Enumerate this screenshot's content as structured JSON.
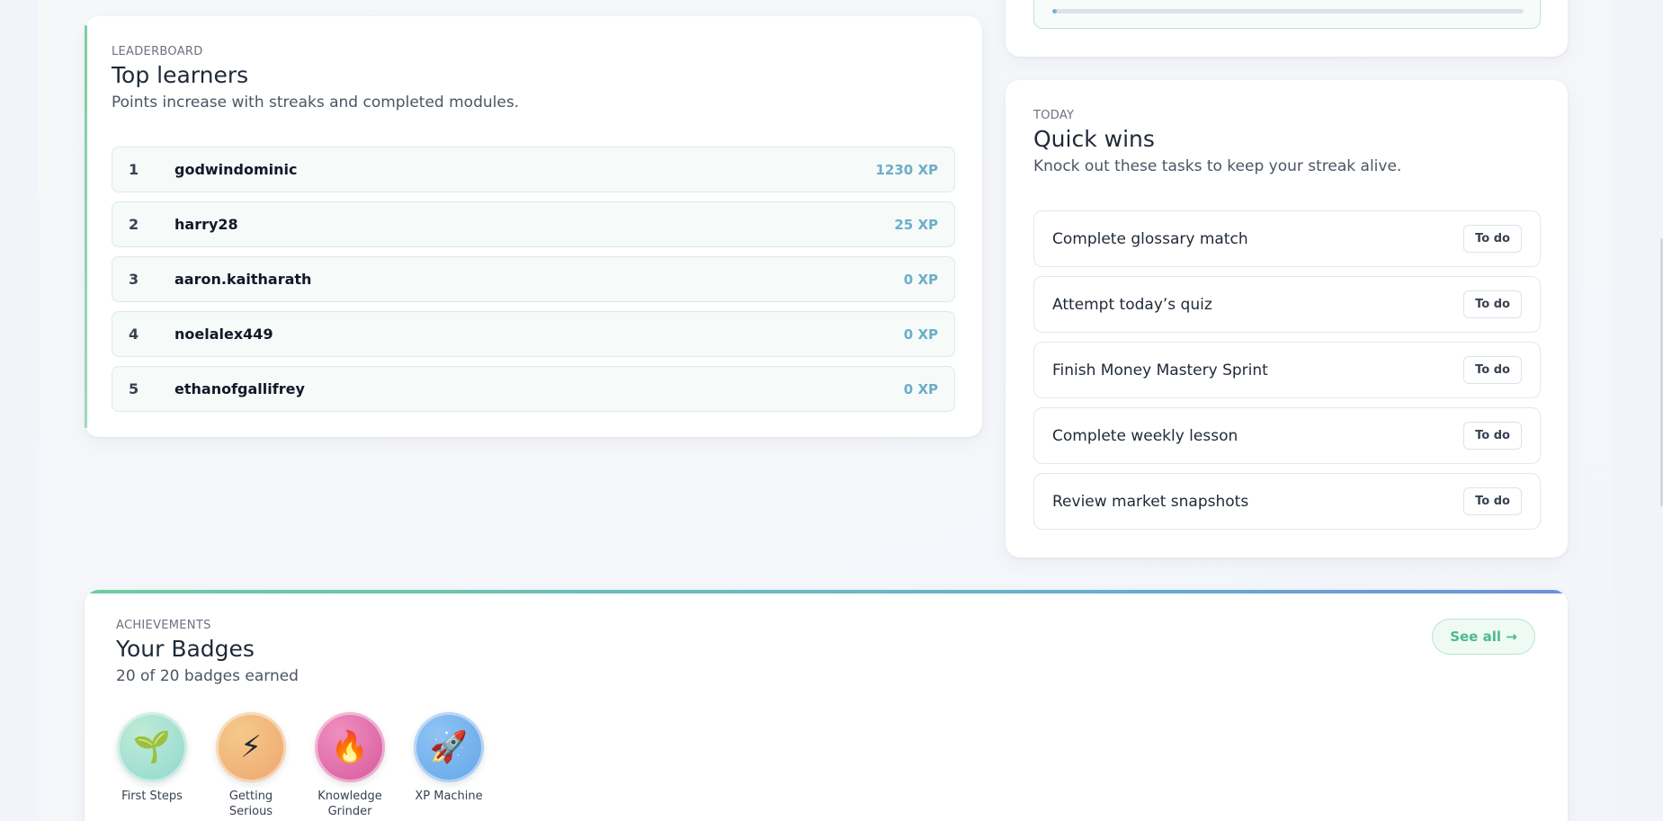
{
  "progress": {
    "fraction": 0.01
  },
  "leaderboard": {
    "eyebrow": "LEADERBOARD",
    "title": "Top learners",
    "subtitle": "Points increase with streaks and completed modules.",
    "rows": [
      {
        "rank": "1",
        "name": "godwindominic",
        "xp": "1230 XP"
      },
      {
        "rank": "2",
        "name": "harry28",
        "xp": "25 XP"
      },
      {
        "rank": "3",
        "name": "aaron.kaitharath",
        "xp": "0 XP"
      },
      {
        "rank": "4",
        "name": "noelalex449",
        "xp": "0 XP"
      },
      {
        "rank": "5",
        "name": "ethanofgallifrey",
        "xp": "0 XP"
      }
    ]
  },
  "quickwins": {
    "eyebrow": "TODAY",
    "title": "Quick wins",
    "subtitle": "Knock out these tasks to keep your streak alive.",
    "tasks": [
      {
        "label": "Complete glossary match",
        "status": "To do"
      },
      {
        "label": "Attempt today’s quiz",
        "status": "To do"
      },
      {
        "label": "Finish Money Mastery Sprint",
        "status": "To do"
      },
      {
        "label": "Complete weekly lesson",
        "status": "To do"
      },
      {
        "label": "Review market snapshots",
        "status": "To do"
      }
    ]
  },
  "badges": {
    "eyebrow": "ACHIEVEMENTS",
    "title": "Your Badges",
    "subtitle": "20 of 20 badges earned",
    "see_all": "See all →",
    "items": [
      {
        "label": "First Steps",
        "icon": "seedling-icon",
        "glyph": "🌱",
        "color_a": "#bfead6",
        "color_b": "#8fd8d0"
      },
      {
        "label": "Getting Serious",
        "icon": "lightning-icon",
        "glyph": "⚡",
        "color_a": "#f5c98a",
        "color_b": "#eea56e"
      },
      {
        "label": "Knowledge Grinder",
        "icon": "fire-icon",
        "glyph": "🔥",
        "color_a": "#ef8fc0",
        "color_b": "#d6579a"
      },
      {
        "label": "XP Machine",
        "icon": "rocket-icon",
        "glyph": "🚀",
        "color_a": "#8fc3f3",
        "color_b": "#62a5e8"
      }
    ]
  }
}
